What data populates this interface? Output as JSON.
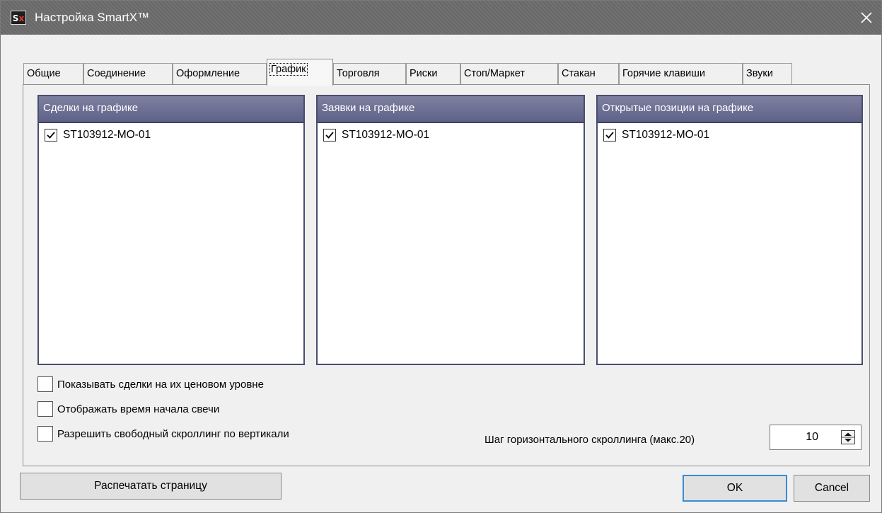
{
  "window": {
    "title": "Настройка SmartX™",
    "app_icon": {
      "letters": "Sx",
      "icon": "smartx-logo-icon"
    },
    "close_icon": "close-icon"
  },
  "tabs": [
    {
      "label": "Общие",
      "active": false
    },
    {
      "label": "Соединение",
      "active": false
    },
    {
      "label": "Оформление",
      "active": false
    },
    {
      "label": "График",
      "active": true
    },
    {
      "label": "Торговля",
      "active": false
    },
    {
      "label": "Риски",
      "active": false
    },
    {
      "label": "Стоп/Маркет",
      "active": false
    },
    {
      "label": "Стакан",
      "active": false
    },
    {
      "label": "Горячие клавиши",
      "active": false
    },
    {
      "label": "Звуки",
      "active": false
    }
  ],
  "groups": [
    {
      "title": "Сделки на графике",
      "items": [
        {
          "label": "ST103912-MO-01",
          "checked": true
        }
      ]
    },
    {
      "title": "Заявки на графике",
      "items": [
        {
          "label": "ST103912-MO-01",
          "checked": true
        }
      ]
    },
    {
      "title": "Открытые позиции на графике",
      "items": [
        {
          "label": "ST103912-MO-01",
          "checked": true
        }
      ]
    }
  ],
  "options": [
    {
      "label": "Показывать сделки на их ценовом уровне",
      "checked": false
    },
    {
      "label": "Отображать время начала свечи",
      "checked": false
    },
    {
      "label": "Разрешить свободный скроллинг по вертикали",
      "checked": false
    }
  ],
  "scroll_step": {
    "label": "Шаг горизонтального скроллинга (макс.20)",
    "value": "10"
  },
  "buttons": {
    "print": "Распечатать страницу",
    "ok": "OK",
    "cancel": "Cancel"
  },
  "colors": {
    "titlebar": "#6c6c6c",
    "group_header": "#5f6288",
    "default_button_border": "#3b8bd6"
  }
}
